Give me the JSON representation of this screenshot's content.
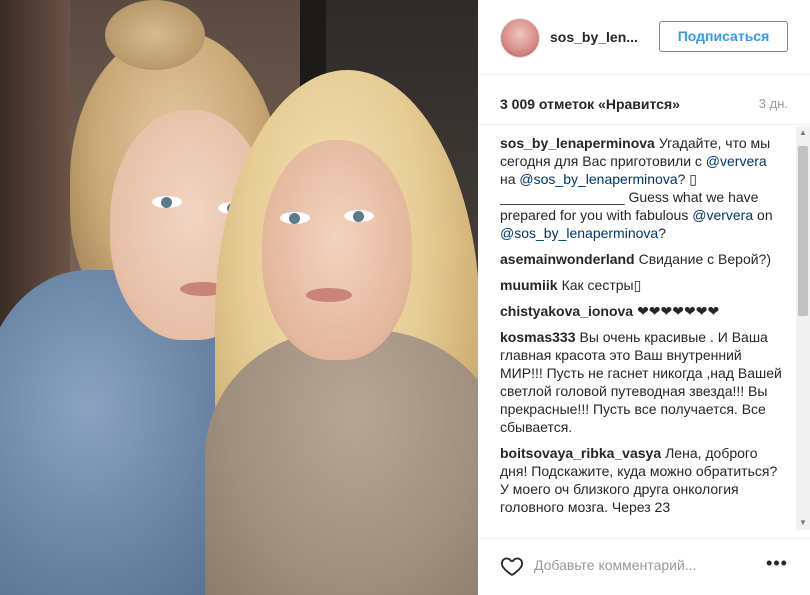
{
  "header": {
    "username": "sos_by_len...",
    "follow_label": "Подписаться"
  },
  "stats": {
    "likes": "3 009 отметок «Нравится»",
    "time": "3 дн."
  },
  "comments": [
    {
      "author": "sos_by_lenaperminova",
      "parts": [
        {
          "text": "Угадайте, что мы сегодня для Вас приготовили с "
        },
        {
          "text": "@ververa",
          "mention": true
        },
        {
          "text": " на "
        },
        {
          "text": "@sos_by_lenaperminova",
          "mention": true
        },
        {
          "text": "? ▯ ________________ Guess what we have prepared for you with fabulous "
        },
        {
          "text": "@ververa",
          "mention": true
        },
        {
          "text": " on "
        },
        {
          "text": "@sos_by_lenaperminova",
          "mention": true
        },
        {
          "text": "?"
        }
      ]
    },
    {
      "author": "asemainwonderland",
      "parts": [
        {
          "text": "Свидание с Верой?)"
        }
      ]
    },
    {
      "author": "muumiik",
      "parts": [
        {
          "text": "Как сестры▯"
        }
      ]
    },
    {
      "author": "chistyakova_ionova",
      "parts": [
        {
          "text": "❤❤❤❤❤❤❤"
        }
      ]
    },
    {
      "author": "kosmas333",
      "parts": [
        {
          "text": "Вы очень красивые . И Ваша главная красота это Ваш внутренний МИР!!! Пусть не гаснет никогда ,над Вашей светлой головой путеводная звезда!!! Вы прекрасные!!! Пусть все получается. Все сбывается."
        }
      ]
    },
    {
      "author": "boitsovaya_ribka_vasya",
      "parts": [
        {
          "text": "Лена, доброго дня! Подскажите, куда можно обратиться? У моего оч близкого друга онкология головного мозга. Через 23"
        }
      ]
    }
  ],
  "composer": {
    "placeholder": "Добавьте комментарий...",
    "more_label": "•••"
  },
  "icons": {
    "like": "heart-icon",
    "more": "more-options-icon"
  }
}
